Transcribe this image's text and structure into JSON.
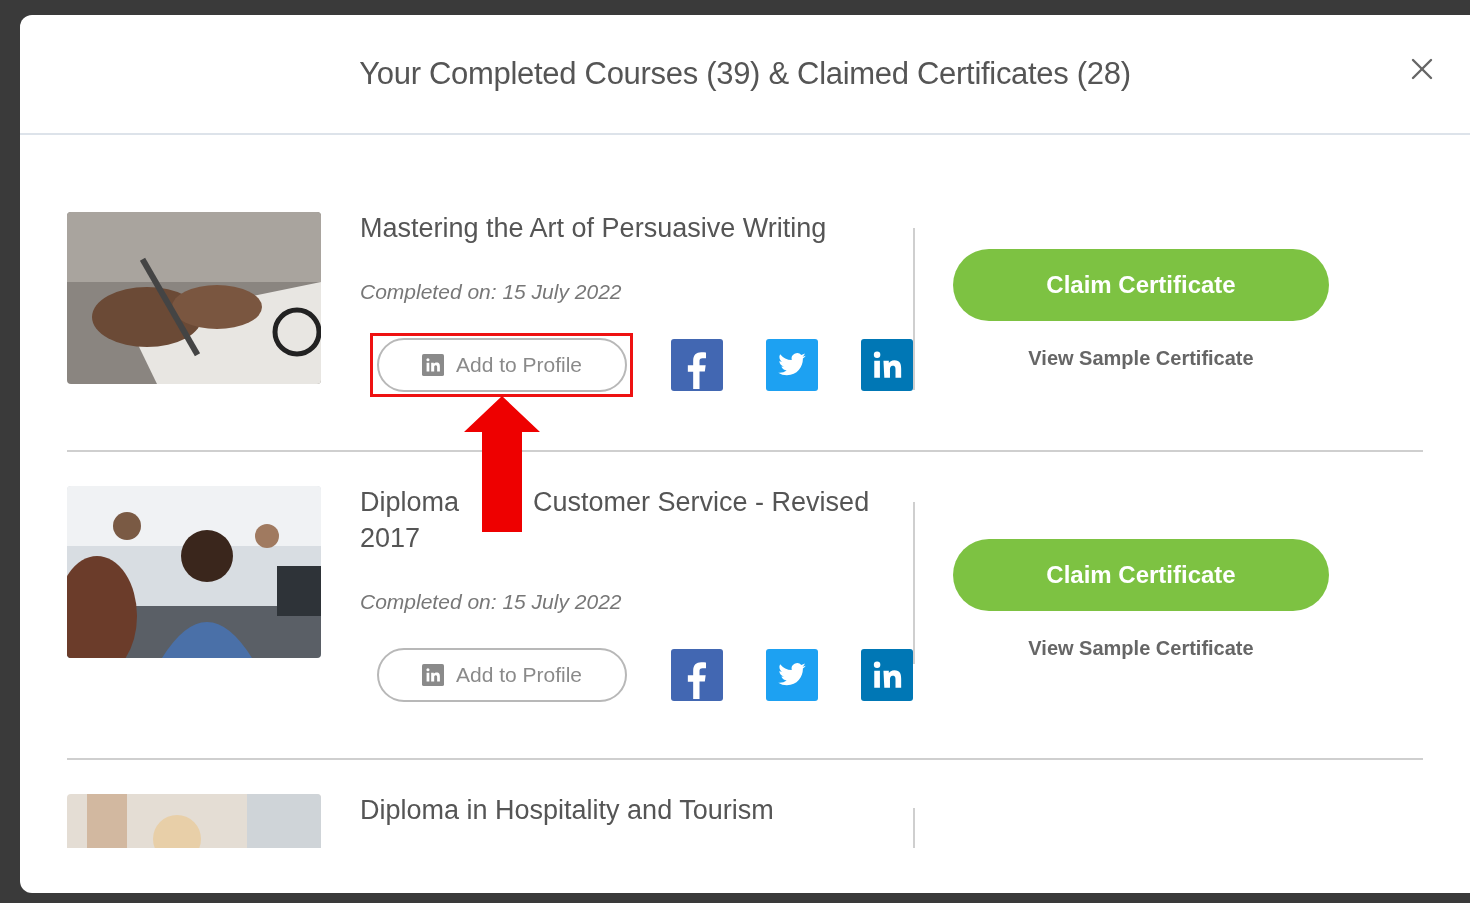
{
  "dialog": {
    "title": "Your Completed Courses (39) & Claimed Certificates (28)"
  },
  "courses": [
    {
      "title_parts": [
        "Mastering the Art of Persuasive Writing"
      ],
      "completed": "Completed on: 15 July 2022",
      "add_to_profile": "Add to Profile",
      "highlighted": true,
      "claim": "Claim Certificate",
      "sample": "View Sample Certificate"
    },
    {
      "title_parts": [
        "Diploma",
        "Customer Service - Revised 2017"
      ],
      "completed": "Completed on: 15 July 2022",
      "add_to_profile": "Add to Profile",
      "highlighted": false,
      "claim": "Claim Certificate",
      "sample": "View Sample Certificate"
    },
    {
      "title_parts": [
        "Diploma in Hospitality and Tourism"
      ]
    }
  ]
}
